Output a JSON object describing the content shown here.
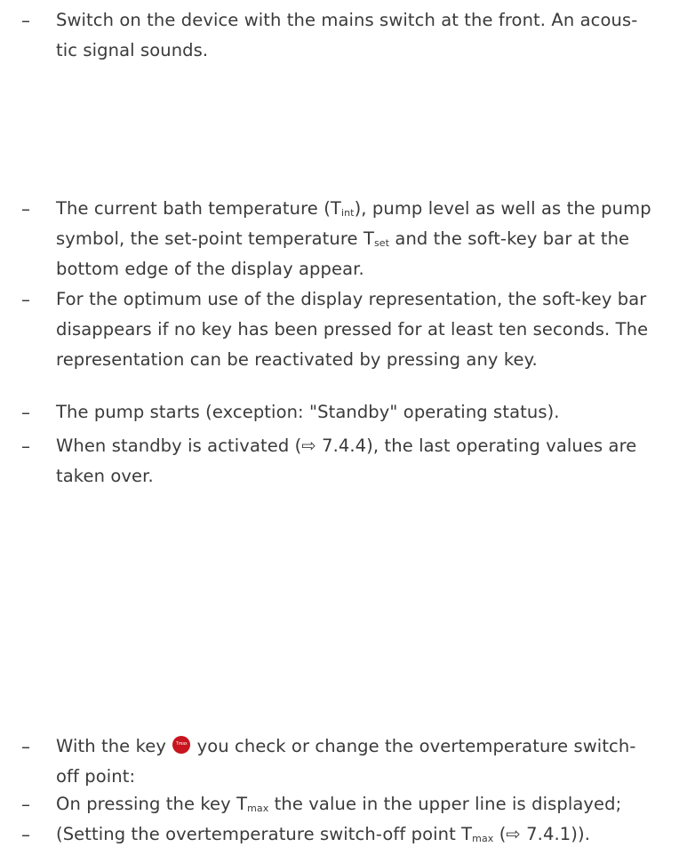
{
  "items": {
    "i1": {
      "line1": "Switch on the device with the mains switch at the front. An acous-",
      "line2": "tic signal sounds."
    },
    "i2": {
      "l1_a": "The current bath temperature (T",
      "l1_sub": "int",
      "l1_b": "), pump level as well as the pump",
      "l2_a": "symbol, the set-point temperature T",
      "l2_sub": "set",
      "l2_b": " and the soft-key bar at the",
      "l3": "bottom edge of the display appear."
    },
    "i3": {
      "l1": "For the optimum use of the display representation, the soft-key bar",
      "l2": "disappears if no key has been pressed for at least ten seconds. The",
      "l3": "representation can be reactivated by pressing any key."
    },
    "i4": {
      "l1": "The pump starts (exception: \"Standby\" operating status)."
    },
    "i5": {
      "l1": "When standby is activated (⇨ 7.4.4), the last operating values are",
      "l2": "taken over."
    },
    "i6": {
      "l1_a": "With the key ",
      "key_label": "Tmax",
      "l1_b": " you check or change the overtemperature switch-",
      "l2": "off point:"
    },
    "i7": {
      "l1_a": "On pressing the key T",
      "l1_sub": "max",
      "l1_b": " the value in the upper line is displayed;"
    },
    "i8": {
      "l1_a": "(Setting the overtemperature switch-off point T",
      "l1_sub": "max",
      "l1_b": " (⇨ 7.4.1))."
    }
  },
  "bullet": "–",
  "colors": {
    "text": "#3a3a3a",
    "key_icon": "#c7141e"
  }
}
